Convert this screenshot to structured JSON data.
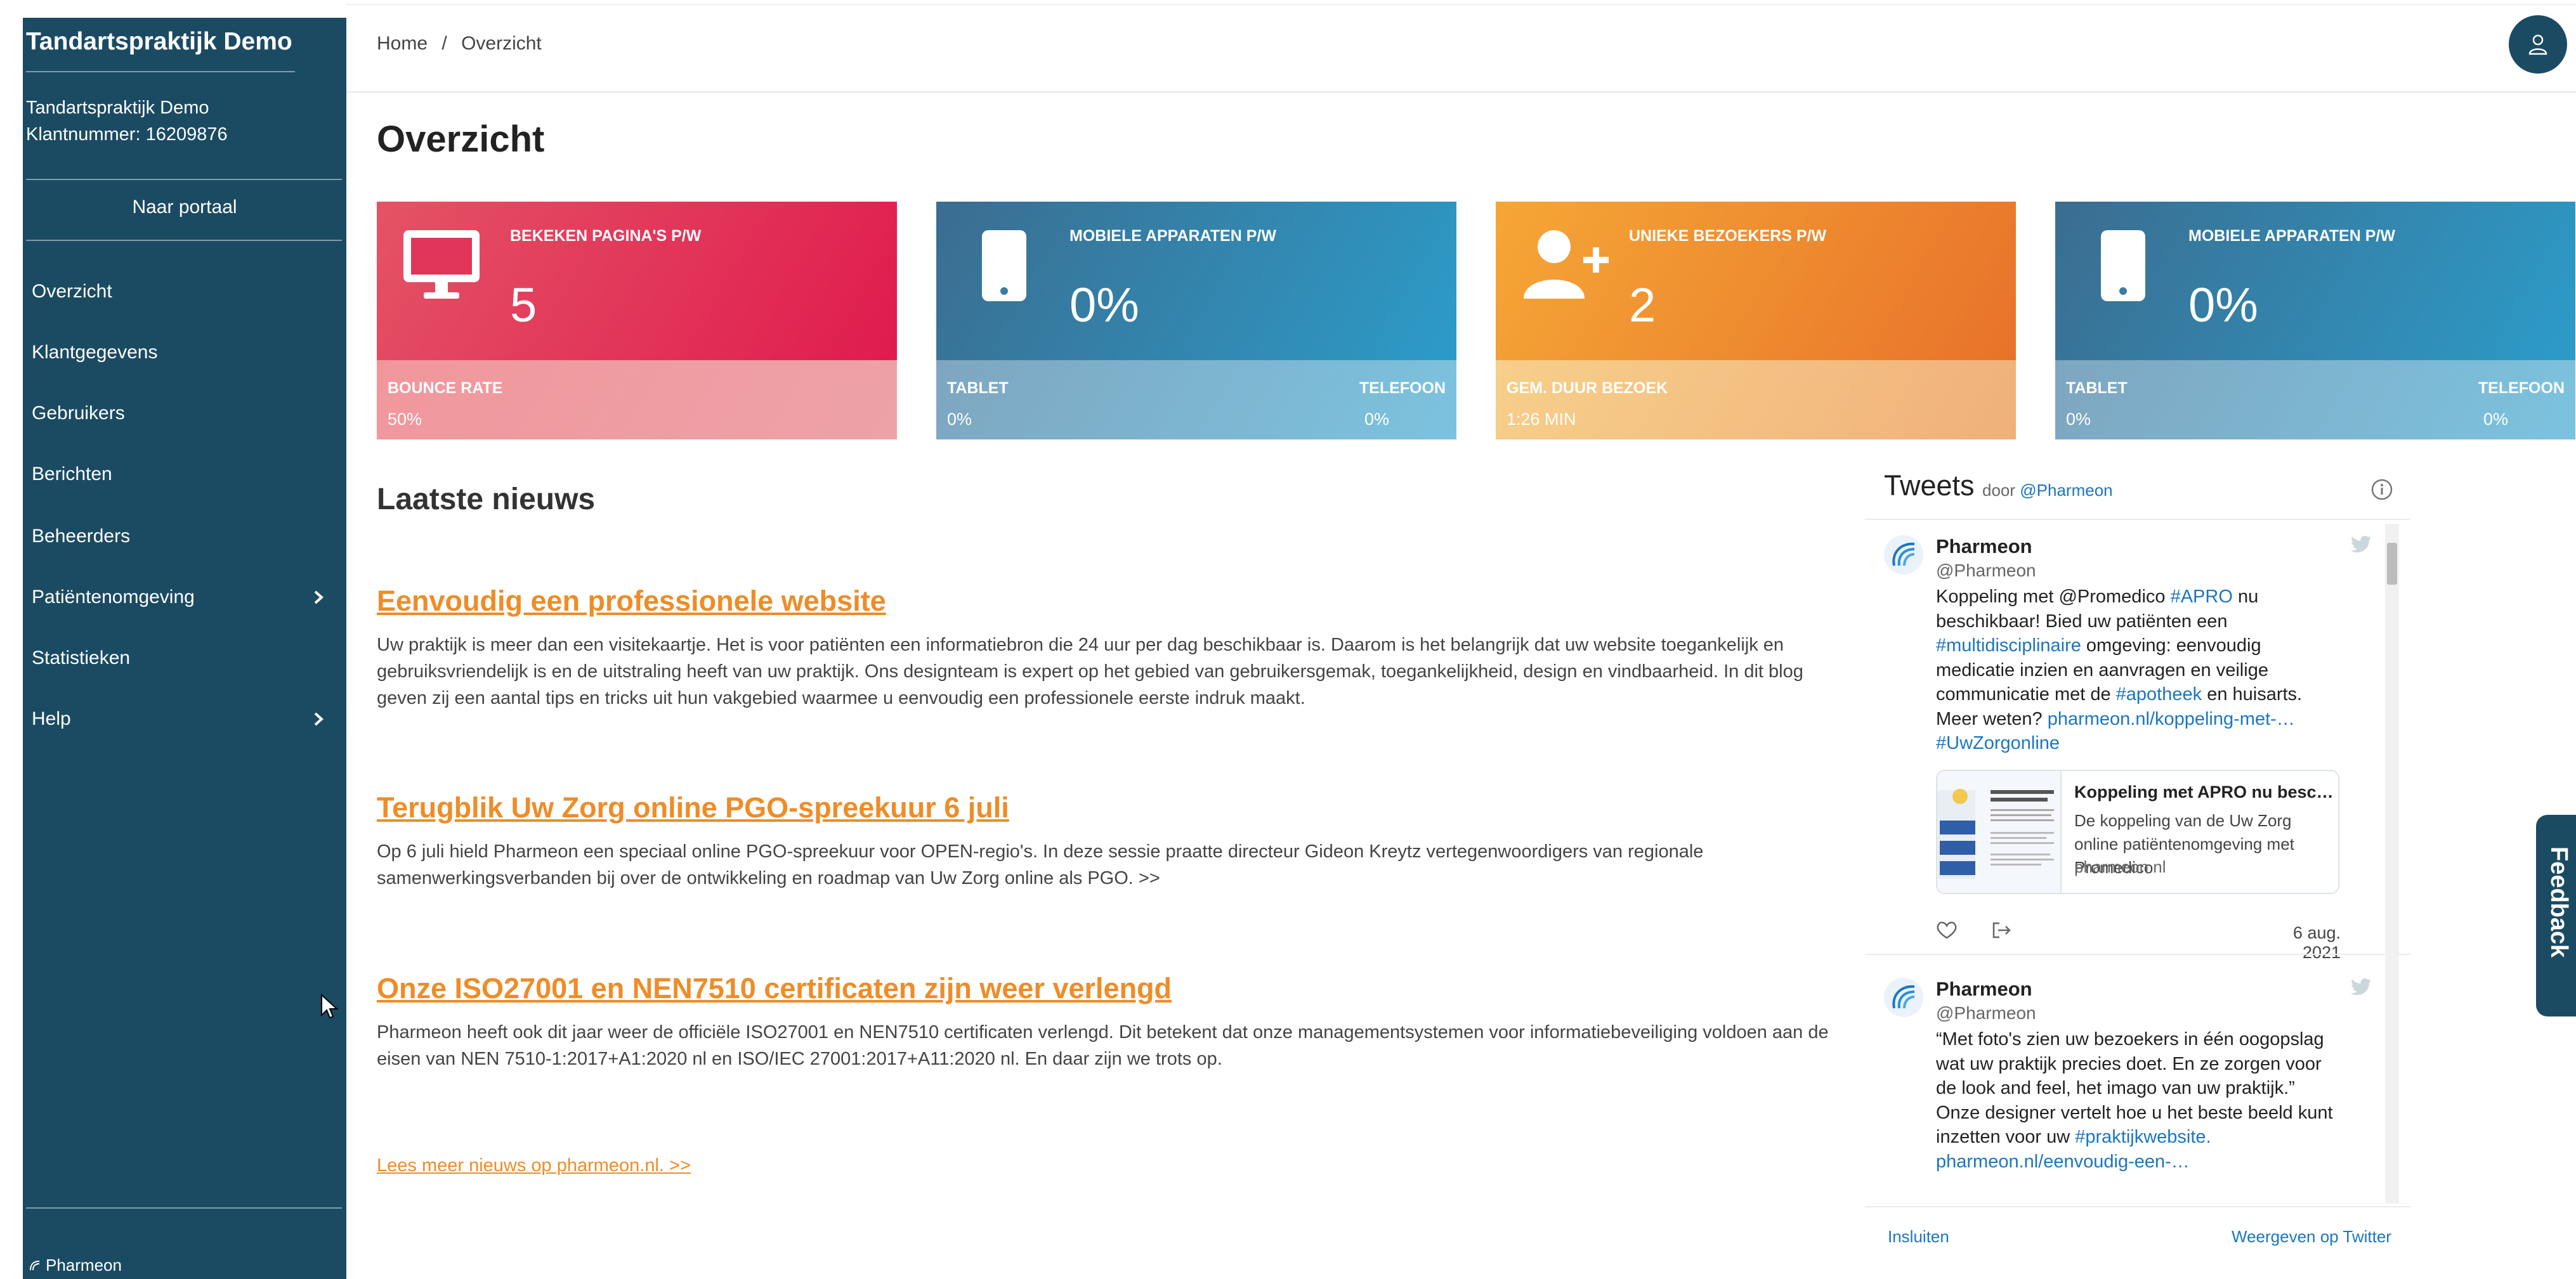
{
  "sidebar": {
    "brand": "Tandartspraktijk Demo",
    "client_name": "Tandartspraktijk Demo",
    "client_number": "Klantnummer: 16209876",
    "portal": "Naar portaal",
    "items": [
      {
        "label": "Overzicht"
      },
      {
        "label": "Klantgegevens"
      },
      {
        "label": "Gebruikers"
      },
      {
        "label": "Berichten"
      },
      {
        "label": "Beheerders"
      },
      {
        "label": "Patiëntenomgeving"
      },
      {
        "label": "Statistieken"
      },
      {
        "label": "Help"
      }
    ],
    "footer": "Pharmeon"
  },
  "breadcrumb": {
    "home": "Home",
    "sep": "/",
    "current": "Overzicht"
  },
  "page_title": "Overzicht",
  "cards": [
    {
      "label": "BEKEKEN PAGINA'S P/W",
      "value": "5",
      "icon": "monitor-icon",
      "bottom_left_label": "BOUNCE RATE",
      "bottom_left_value": "50%",
      "bottom_right_label": "",
      "bottom_right_value": ""
    },
    {
      "label": "MOBIELE APPARATEN P/W",
      "value": "0%",
      "icon": "phone-icon",
      "bottom_left_label": "TABLET",
      "bottom_left_value": "0%",
      "bottom_right_label": "TELEFOON",
      "bottom_right_value": "0%"
    },
    {
      "label": "UNIEKE BEZOEKERS P/W",
      "value": "2",
      "icon": "user-plus-icon",
      "bottom_left_label": "GEM. DUUR BEZOEK",
      "bottom_left_value": "1:26 MIN",
      "bottom_right_label": "",
      "bottom_right_value": ""
    },
    {
      "label": "MOBIELE APPARATEN P/W",
      "value": "0%",
      "icon": "phone-icon",
      "bottom_left_label": "TABLET",
      "bottom_left_value": "0%",
      "bottom_right_label": "TELEFOON",
      "bottom_right_value": "0%"
    }
  ],
  "news": {
    "heading": "Laatste nieuws",
    "articles": [
      {
        "title": "Eenvoudig een professionele website",
        "body": "Uw praktijk is meer dan een visitekaartje. Het is voor patiënten een informatiebron die 24 uur per dag beschikbaar is. Daarom is het belangrijk dat uw website toegankelijk en gebruiksvriendelijk is en de uitstraling heeft van uw praktijk. Ons designteam is expert op het gebied van gebruikersgemak, toegankelijkheid, design en vindbaarheid. In dit blog geven zij een aantal tips en tricks uit hun vakgebied waarmee u eenvoudig een professionele eerste indruk maakt."
      },
      {
        "title": "Terugblik Uw Zorg online PGO-spreekuur 6 juli",
        "body": "Op 6 juli hield Pharmeon een speciaal online PGO-spreekuur voor OPEN-regio's. In deze sessie praatte directeur Gideon Kreytz vertegenwoordigers van regionale samenwerkingsverbanden bij over de ontwikkeling en roadmap van Uw Zorg online als PGO. >>"
      },
      {
        "title": "Onze ISO27001 en NEN7510 certificaten zijn weer verlengd",
        "body": "Pharmeon heeft ook dit jaar weer de officiële ISO27001 en NEN7510 certificaten verlengd. Dit betekent dat onze managementsystemen voor informatiebeveiliging voldoen aan de eisen van NEN 7510-1:2017+A1:2020 nl en ISO/IEC 27001:2017+A11:2020 nl. En daar zijn we trots op."
      }
    ],
    "more": "Lees meer nieuws op pharmeon.nl. >>"
  },
  "tweets": {
    "title": "Tweets",
    "by_prefix": "door",
    "by_handle": "@Pharmeon",
    "items": [
      {
        "name": "Pharmeon",
        "handle": "@Pharmeon",
        "text_parts": [
          {
            "t": "Koppeling met @Promedico ",
            "link": false
          },
          {
            "t": "#APRO",
            "link": true
          },
          {
            "t": " nu beschikbaar! Bied uw patiënten een ",
            "link": false
          },
          {
            "t": "#multidisciplinaire",
            "link": true
          },
          {
            "t": " omgeving: eenvoudig medicatie inzien en aanvragen en veilige communicatie met de ",
            "link": false
          },
          {
            "t": "#apotheek",
            "link": true
          },
          {
            "t": " en huisarts. Meer weten? ",
            "link": false
          },
          {
            "t": "pharmeon.nl/koppeling-met-…",
            "link": true
          },
          {
            "t": " ",
            "link": false
          },
          {
            "t": "#UwZorgonline",
            "link": true
          }
        ],
        "card_title": "Koppeling met APRO nu beschikbaar",
        "card_desc": "De koppeling van de Uw Zorg online patiëntenomgeving met Promedico",
        "card_site": "pharmeon.nl",
        "date": "6 aug. 2021"
      },
      {
        "name": "Pharmeon",
        "handle": "@Pharmeon",
        "text_parts": [
          {
            "t": "“Met foto's zien uw bezoekers in één oogopslag wat uw praktijk precies doet. En ze zorgen voor de look and feel, het imago van uw praktijk.” Onze designer vertelt hoe u het beste beeld kunt inzetten voor uw ",
            "link": false
          },
          {
            "t": "#praktijkwebsite",
            "link": true
          },
          {
            "t": ". ",
            "link": false
          },
          {
            "t": "pharmeon.nl/eenvoudig-een-…",
            "link": true
          }
        ]
      }
    ],
    "login": "Insluiten",
    "view": "Weergeven op Twitter"
  },
  "feedback": "Feedback",
  "colors": {
    "sidebar": "#1b4b63",
    "accent_orange": "#ef8c27",
    "link_blue": "#1b76c0"
  }
}
